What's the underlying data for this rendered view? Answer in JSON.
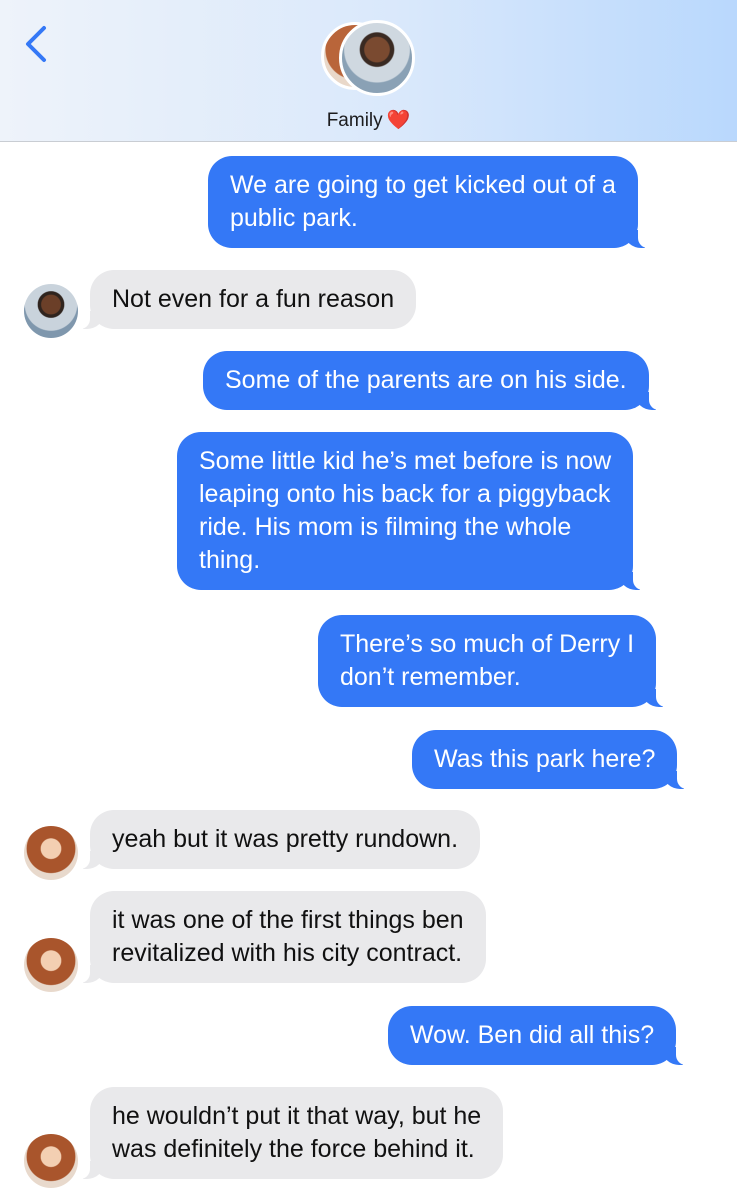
{
  "header": {
    "group_name": "Family",
    "heart": "❤️",
    "back_icon": "chevron-left-icon",
    "accent_color": "#3478f6"
  },
  "messages": [
    {
      "direction": "out",
      "lines": [
        "We are going to get kicked out of a",
        "public park."
      ]
    },
    {
      "direction": "in",
      "sender": "man",
      "lines": [
        "Not even for a fun reason"
      ]
    },
    {
      "direction": "out",
      "lines": [
        "Some of the parents are on his side."
      ]
    },
    {
      "direction": "out",
      "lines": [
        "Some little kid he’s met before is now",
        "leaping onto his back for a piggyback",
        "ride. His mom is filming the whole",
        "thing."
      ]
    },
    {
      "direction": "out",
      "lines": [
        "There’s so much of Derry I",
        "don’t remember."
      ]
    },
    {
      "direction": "out",
      "lines": [
        "Was this park here?"
      ]
    },
    {
      "direction": "in",
      "sender": "woman",
      "lines": [
        "yeah but it was pretty rundown."
      ]
    },
    {
      "direction": "in",
      "sender": "woman",
      "lines": [
        "it was one of the first things ben",
        "revitalized with his city contract."
      ]
    },
    {
      "direction": "out",
      "lines": [
        "Wow. Ben did all this?"
      ]
    },
    {
      "direction": "in",
      "sender": "woman",
      "lines": [
        "he wouldn’t put it that way, but he",
        "was definitely the force behind it."
      ]
    }
  ],
  "colors": {
    "outgoing_bubble": "#3478f6",
    "incoming_bubble": "#e9e9eb"
  }
}
